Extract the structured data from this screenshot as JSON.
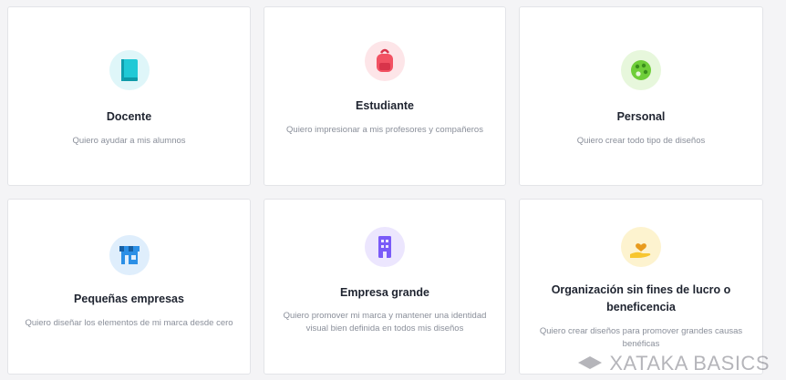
{
  "cards": [
    {
      "title": "Docente",
      "description": "Quiero ayudar a mis alumnos",
      "icon": "book-icon"
    },
    {
      "title": "Estudiante",
      "description": "Quiero impresionar a mis profesores y compañeros",
      "icon": "backpack-icon"
    },
    {
      "title": "Personal",
      "description": "Quiero crear todo tipo de diseños",
      "icon": "palette-icon"
    },
    {
      "title": "Pequeñas empresas",
      "description": "Quiero diseñar los elementos de mi marca desde cero",
      "icon": "storefront-icon"
    },
    {
      "title": "Empresa grande",
      "description": "Quiero promover mi marca y mantener una identidad visual bien definida en todos mis diseños",
      "icon": "building-icon"
    },
    {
      "title": "Organización sin fines de lucro o beneficencia",
      "description": "Quiero crear diseños para promover grandes causas benéficas",
      "icon": "hand-heart-icon"
    }
  ],
  "watermark": {
    "text": "XATAKA BASICS"
  },
  "colors": {
    "teal": "#20c9d6",
    "red": "#f25263",
    "green": "#6fce3a",
    "blue": "#2b8fe6",
    "purple": "#7a5af8",
    "yellow": "#f7c62f"
  }
}
